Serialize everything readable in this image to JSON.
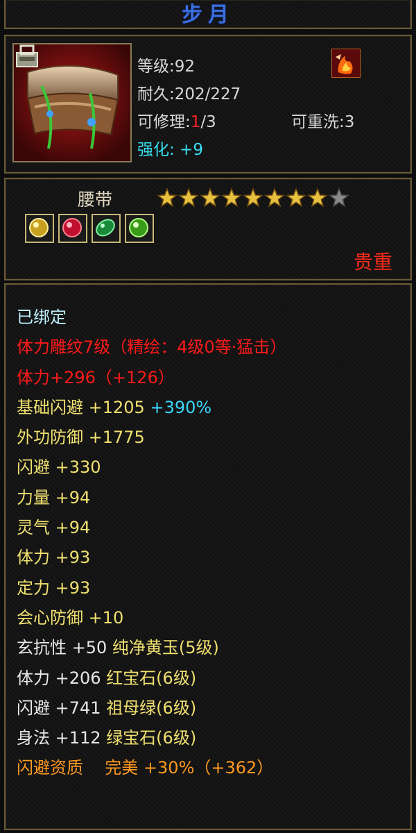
{
  "title": "步月",
  "info": {
    "level_label": "等级",
    "level_value": ":92",
    "durability_label": "耐久",
    "durability_value": ":202/227",
    "repair_label": "可修理",
    "repair_used": "1",
    "repair_total": "/3",
    "rewash_label": "可重洗",
    "rewash_value": ":3",
    "enhance_label": "强化",
    "enhance_value": ": +9"
  },
  "item": {
    "type": "腰带",
    "stars_total": 9,
    "stars_filled": 8,
    "quality": "贵重",
    "gems": [
      "yellow-gem",
      "red-gem",
      "green-gem",
      "green-gem"
    ]
  },
  "attributes": {
    "bound": "已绑定",
    "engrave": "体力雕纹7级（精绘：4级0等·猛击）",
    "stamina_main": "体力+296（+126）",
    "base_dodge": "基础闪避 +1205",
    "base_dodge_bonus": "+390%",
    "outer_defense": "外功防御 +1775",
    "dodge": "闪避 +330",
    "strength": "力量 +94",
    "spirit": "灵气 +94",
    "stamina": "体力 +93",
    "focus": "定力 +93",
    "crit_defense": "会心防御 +10",
    "gem1_stat": "玄抗性 +50",
    "gem1_name": "纯净黄玉(5级)",
    "gem2_stat": "体力 +206",
    "gem2_name": "红宝石(6级)",
    "gem3_stat": "闪避 +741",
    "gem3_name": "祖母绿(6级)",
    "gem4_stat": "身法 +112",
    "gem4_name": "绿宝石(6级)",
    "aptitude_label": "闪避资质",
    "aptitude_grade": "完美",
    "aptitude_value": "+30%（+362）"
  },
  "colors": {
    "title": "#3a6fe0",
    "quality": "#ff2a1a",
    "bound": "#bff0ff",
    "red_attr": "#ff1a1a",
    "yellow_attr": "#f0e070",
    "orange_attr": "#ff9a20",
    "cyan_attr": "#3ad8ff"
  }
}
